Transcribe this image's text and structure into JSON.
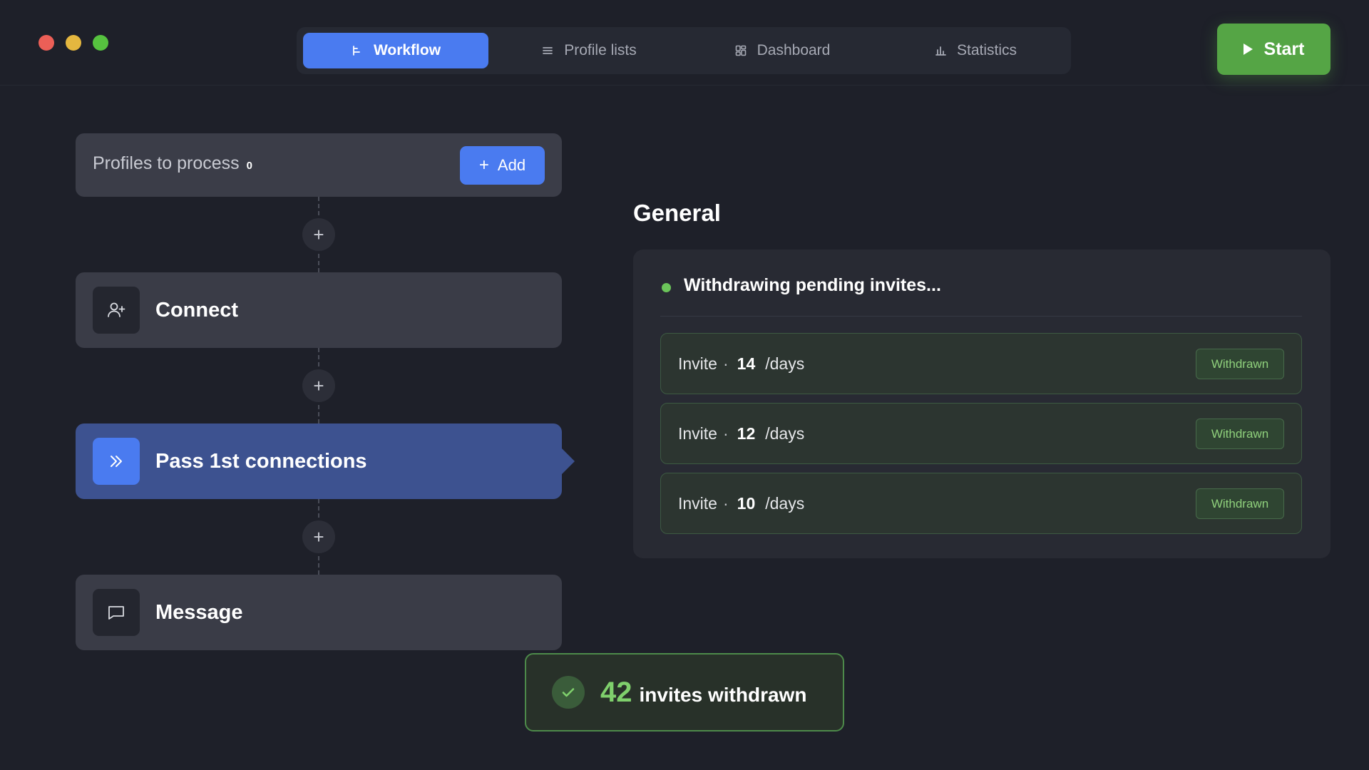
{
  "nav": {
    "tabs": [
      {
        "label": "Workflow",
        "icon": "workflow-icon",
        "active": true
      },
      {
        "label": "Profile lists",
        "icon": "list-icon",
        "active": false
      },
      {
        "label": "Dashboard",
        "icon": "dashboard-icon",
        "active": false
      },
      {
        "label": "Statistics",
        "icon": "bar-chart-icon",
        "active": false
      }
    ],
    "start_label": "Start"
  },
  "workflow": {
    "profiles_label": "Profiles to process",
    "profiles_count": "0",
    "add_label": "Add",
    "steps": [
      {
        "label": "Connect",
        "icon": "user-plus-icon",
        "active": false
      },
      {
        "label": "Pass 1st connections",
        "icon": "double-chevron-right-icon",
        "active": true
      },
      {
        "label": "Message",
        "icon": "message-icon",
        "active": false
      }
    ],
    "add_step_symbol": "+"
  },
  "general": {
    "title": "General",
    "status_text": "Withdrawing pending invites...",
    "invites": [
      {
        "label": "Invite",
        "separator": "·",
        "days": "14",
        "unit": "/days",
        "status": "Withdrawn"
      },
      {
        "label": "Invite",
        "separator": "·",
        "days": "12",
        "unit": "/days",
        "status": "Withdrawn"
      },
      {
        "label": "Invite",
        "separator": "·",
        "days": "10",
        "unit": "/days",
        "status": "Withdrawn"
      }
    ]
  },
  "toast": {
    "count": "42",
    "label": "invites withdrawn"
  },
  "colors": {
    "background": "#1e2029",
    "accent_blue": "#4a7bf0",
    "accent_green": "#55a545",
    "success_text": "#7fd06c"
  }
}
